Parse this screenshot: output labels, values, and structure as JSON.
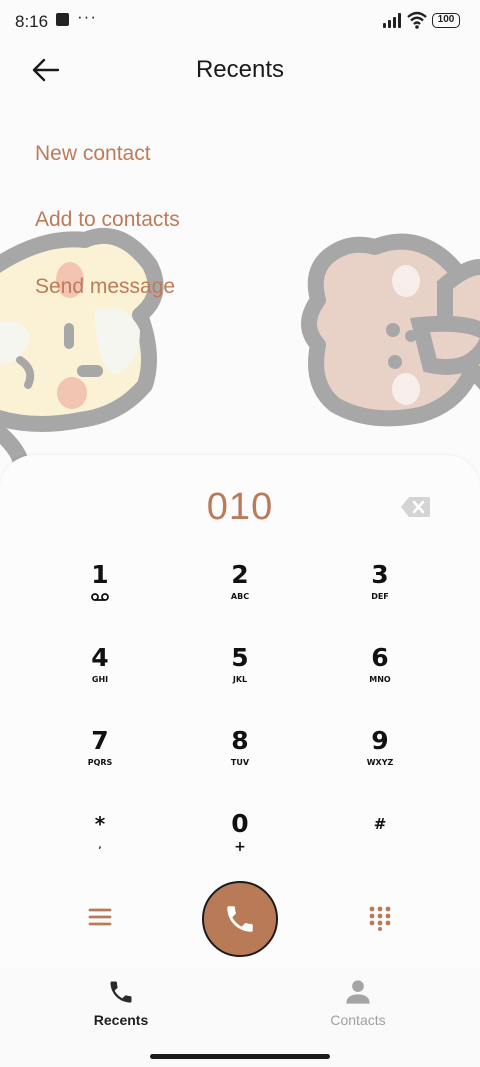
{
  "status_bar": {
    "time": "8:16",
    "dots": "···",
    "battery": "100"
  },
  "header": {
    "title": "Recents",
    "back_icon": "arrow-left-icon"
  },
  "menu": {
    "items": [
      {
        "label": "New contact"
      },
      {
        "label": "Add to contacts"
      },
      {
        "label": "Send message"
      }
    ]
  },
  "dialer": {
    "number": "010",
    "backspace_icon": "backspace-icon",
    "keys": [
      {
        "digit": "1",
        "letters": ""
      },
      {
        "digit": "2",
        "letters": "ABC"
      },
      {
        "digit": "3",
        "letters": "DEF"
      },
      {
        "digit": "4",
        "letters": "GHI"
      },
      {
        "digit": "5",
        "letters": "JKL"
      },
      {
        "digit": "6",
        "letters": "MNO"
      },
      {
        "digit": "7",
        "letters": "PQRS"
      },
      {
        "digit": "8",
        "letters": "TUV"
      },
      {
        "digit": "9",
        "letters": "WXYZ"
      },
      {
        "digit": "*",
        "letters": ","
      },
      {
        "digit": "0",
        "letters": "+"
      },
      {
        "digit": "#",
        "letters": ""
      }
    ],
    "accent_color": "#b97a57"
  },
  "bottom_nav": {
    "items": [
      {
        "label": "Recents",
        "icon": "phone-icon",
        "active": true
      },
      {
        "label": "Contacts",
        "icon": "person-icon",
        "active": false
      }
    ]
  }
}
